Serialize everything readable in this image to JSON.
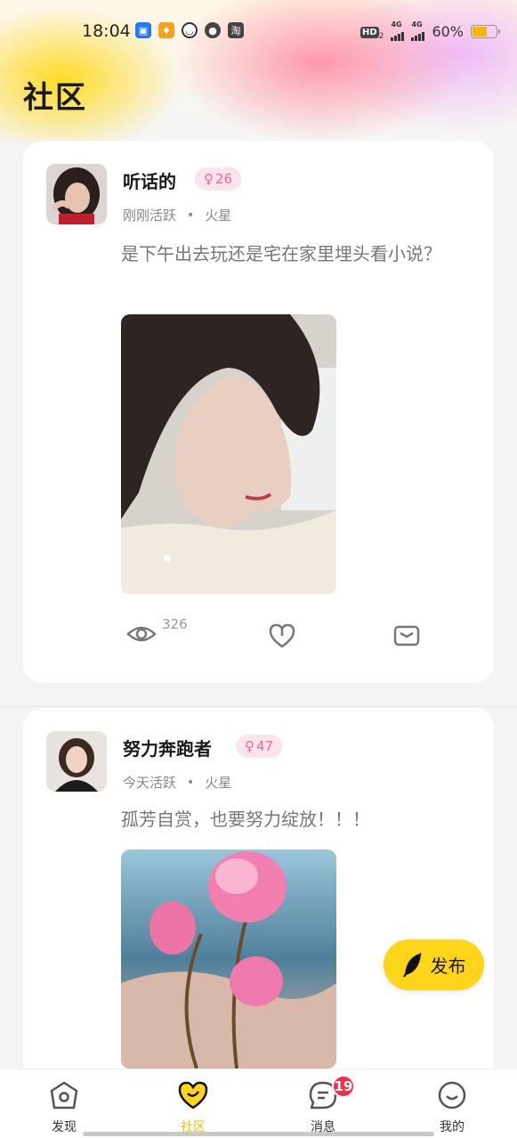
{
  "status_bar": {
    "time": "18:04",
    "hd": "HD",
    "hd_sub": "2",
    "net1": "4G",
    "net2": "4G",
    "battery": "60%",
    "battery_level": 0.6
  },
  "page": {
    "title": "社区"
  },
  "posts": [
    {
      "username": "听话的",
      "gender_symbol": "♀",
      "age": "26",
      "active": "刚刚活跃",
      "sep": "•",
      "location": "火星",
      "text": "是下午出去玩还是宅在家里埋头看小说？",
      "views": "326"
    },
    {
      "username": "努力奔跑者",
      "gender_symbol": "♀",
      "age": "47",
      "active": "今天活跃",
      "sep": "•",
      "location": "火星",
      "text": "孤芳自赏，也要努力绽放！！！"
    }
  ],
  "fab": {
    "label": "发布"
  },
  "nav": {
    "items": [
      {
        "label": "发现",
        "icon": "home-icon"
      },
      {
        "label": "社区",
        "icon": "heart-icon"
      },
      {
        "label": "消息",
        "icon": "chat-icon",
        "badge": "19"
      },
      {
        "label": "我的",
        "icon": "smile-icon"
      }
    ],
    "active_color": "#f2b800"
  },
  "colors": {
    "accent": "#ffd51a",
    "badge": "#f0304a",
    "age_badge": "#fde3ec"
  }
}
